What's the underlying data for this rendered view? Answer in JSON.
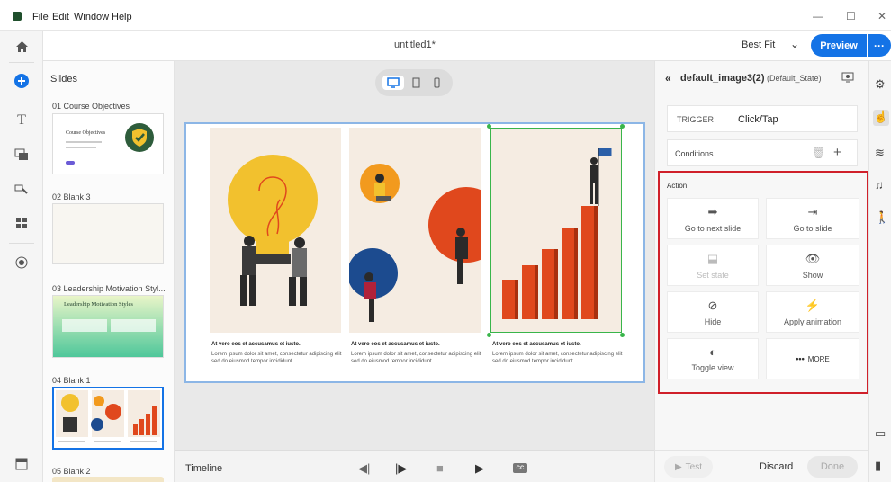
{
  "menu": {
    "items": [
      "File",
      "Edit",
      "Window",
      "Help"
    ],
    "window_controls": [
      "—",
      "☐",
      "✕"
    ]
  },
  "topbar": {
    "title": "untitled1*",
    "zoom": "Best Fit",
    "preview_label": "Preview",
    "more_label": "···"
  },
  "slides_panel": {
    "title": "Slides",
    "slides": [
      {
        "label": "01 Course Objectives",
        "thumb_title": "Course Objectives"
      },
      {
        "label": "02 Blank 3"
      },
      {
        "label": "03 Leadership Motivation Styl...",
        "thumb_title": "Leadership Motivation Styles"
      },
      {
        "label": "04 Blank 1"
      },
      {
        "label": "05 Blank 2"
      }
    ]
  },
  "slide": {
    "captions": [
      {
        "title": "At vero eos et accusamus et iusto.",
        "body": "Lorem ipsum dolor sit amet, consectetur adipiscing elit sed do eiusmod tempor incididunt."
      },
      {
        "title": "At vero eos et accusamus et iusto.",
        "body": "Lorem ipsum dolor sit amet, consectetur adipiscing elit sed do eiusmod tempor incididunt."
      },
      {
        "title": "At vero eos et accusamus et iusto.",
        "body": "Lorem ipsum dolor sit amet, consectetur adipiscing elit sed do eiusmod tempor incididunt."
      }
    ]
  },
  "timeline": {
    "label": "Timeline"
  },
  "properties": {
    "object_name": "default_image3(2)",
    "state": "(Default_State)",
    "trigger_label": "TRIGGER",
    "trigger_value": "Click/Tap",
    "conditions_label": "Conditions",
    "action_label": "Action",
    "actions": [
      {
        "label": "Go to next slide",
        "icon": "arrow-right-icon"
      },
      {
        "label": "Go to slide",
        "icon": "enter-slide-icon"
      },
      {
        "label": "Set state",
        "icon": "set-state-icon"
      },
      {
        "label": "Show",
        "icon": "eye-icon"
      },
      {
        "label": "Hide",
        "icon": "eye-off-icon"
      },
      {
        "label": "Apply animation",
        "icon": "animation-icon"
      },
      {
        "label": "Toggle view",
        "icon": "toggle-view-icon"
      },
      {
        "label": "MORE",
        "icon": "more-dots-icon"
      }
    ],
    "test_label": "Test",
    "discard_label": "Discard",
    "done_label": "Done"
  },
  "colors": {
    "accent": "#1473e6",
    "highlight": "#d0202a",
    "bar_orange": "#e0481d",
    "bulb_yellow": "#f2c12e"
  }
}
